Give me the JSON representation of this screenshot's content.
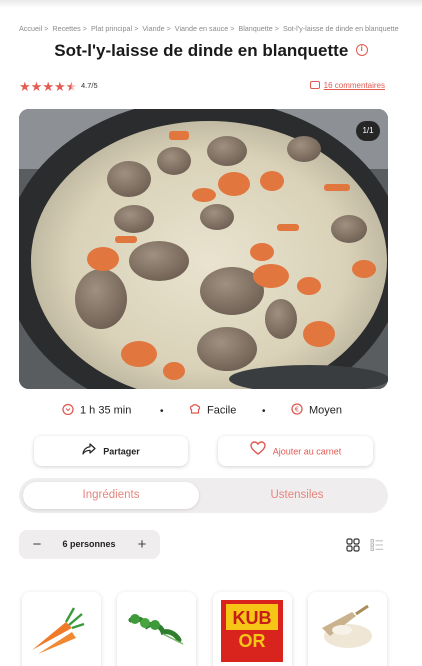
{
  "breadcrumb": {
    "items": [
      "Accueil",
      "Recettes",
      "Plat principal",
      "Viande",
      "Viande en sauce",
      "Blanquette",
      "Sot-l'y-laisse de dinde en blanquette"
    ],
    "separator": ">"
  },
  "recipe": {
    "title": "Sot-l'y-laisse de dinde en blanquette",
    "rating": {
      "stars": 4.5,
      "max": 5,
      "label": "4.7/5"
    },
    "comments_label": "16 commentaires"
  },
  "photo": {
    "counter": "1/1"
  },
  "meta": {
    "time": "1 h 35 min",
    "difficulty": "Facile",
    "cost": "Moyen",
    "separator": "•"
  },
  "actions": {
    "share_label": "Partager",
    "save_label": "Ajouter au carnet"
  },
  "tabs": [
    {
      "label": "Ingrédients",
      "active": true
    },
    {
      "label": "Ustensiles",
      "active": false
    }
  ],
  "servings": {
    "label": "6 personnes",
    "minus": "−",
    "plus": "+"
  },
  "colors": {
    "accent": "#e05a52",
    "accent_light": "#e8847d",
    "pill_background": "#f0edee"
  },
  "icons": {
    "time": "pot-timer-icon",
    "difficulty": "chef-hat-icon",
    "cost": "coin-icon",
    "share": "share-arrow-icon",
    "save": "heart-icon",
    "grid": "grid-view-icon",
    "list": "list-view-icon"
  },
  "ingredients": [
    {
      "name": "carrot"
    },
    {
      "name": "parsley"
    },
    {
      "name": "Kub Or bouillon"
    },
    {
      "name": "flour"
    }
  ],
  "kub_label": {
    "line1": "KUB",
    "line2": "OR"
  }
}
